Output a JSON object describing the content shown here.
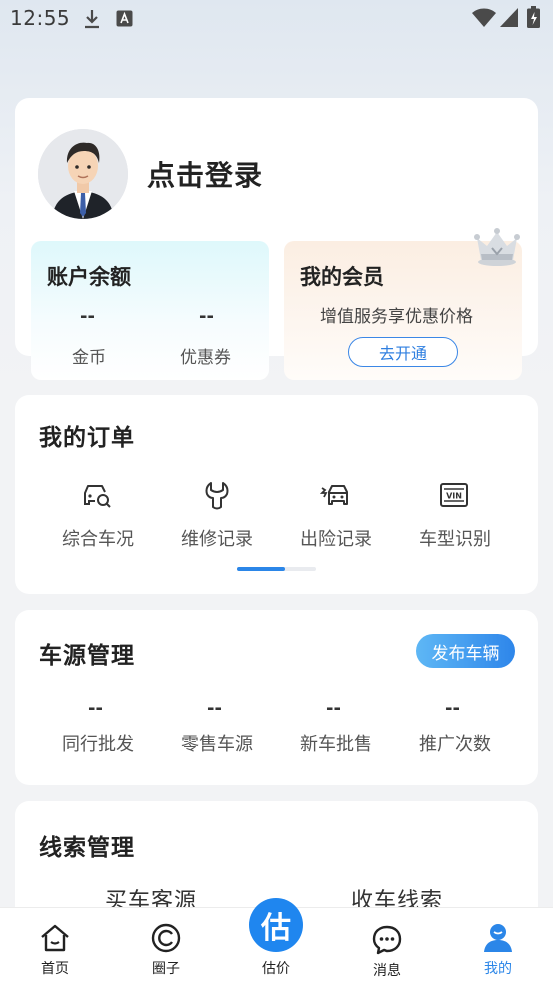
{
  "status_bar": {
    "time": "12:55"
  },
  "profile": {
    "login_prompt": "点击登录"
  },
  "balance": {
    "title": "账户余额",
    "coins_value": "--",
    "coins_label": "金币",
    "coupons_value": "--",
    "coupons_label": "优惠券"
  },
  "membership": {
    "title": "我的会员",
    "description": "增值服务享优惠价格",
    "button_label": "去开通"
  },
  "orders": {
    "title": "我的订单",
    "items": [
      {
        "label": "综合车况",
        "icon": "car-search-icon"
      },
      {
        "label": "维修记录",
        "icon": "wrench-icon"
      },
      {
        "label": "出险记录",
        "icon": "car-crash-icon"
      },
      {
        "label": "车型识别",
        "icon": "vin-icon"
      }
    ],
    "vin_text": "VIN"
  },
  "vehicle_source": {
    "title": "车源管理",
    "publish_label": "发布车辆",
    "stats": [
      {
        "value": "--",
        "label": "同行批发"
      },
      {
        "value": "--",
        "label": "零售车源"
      },
      {
        "value": "--",
        "label": "新车批售"
      },
      {
        "value": "--",
        "label": "推广次数"
      }
    ]
  },
  "leads": {
    "title": "线索管理",
    "buy_label": "买车客源",
    "sell_label": "收车线索"
  },
  "bottom_nav": {
    "items": [
      {
        "label": "首页",
        "icon": "home-icon"
      },
      {
        "label": "圈子",
        "icon": "circle-icon"
      },
      {
        "label": "估价",
        "icon": "estimate-icon"
      },
      {
        "label": "消息",
        "icon": "message-icon"
      },
      {
        "label": "我的",
        "icon": "profile-icon"
      }
    ],
    "fab_text": "估",
    "active_index": 4
  },
  "colors": {
    "accent": "#2b86e8"
  }
}
